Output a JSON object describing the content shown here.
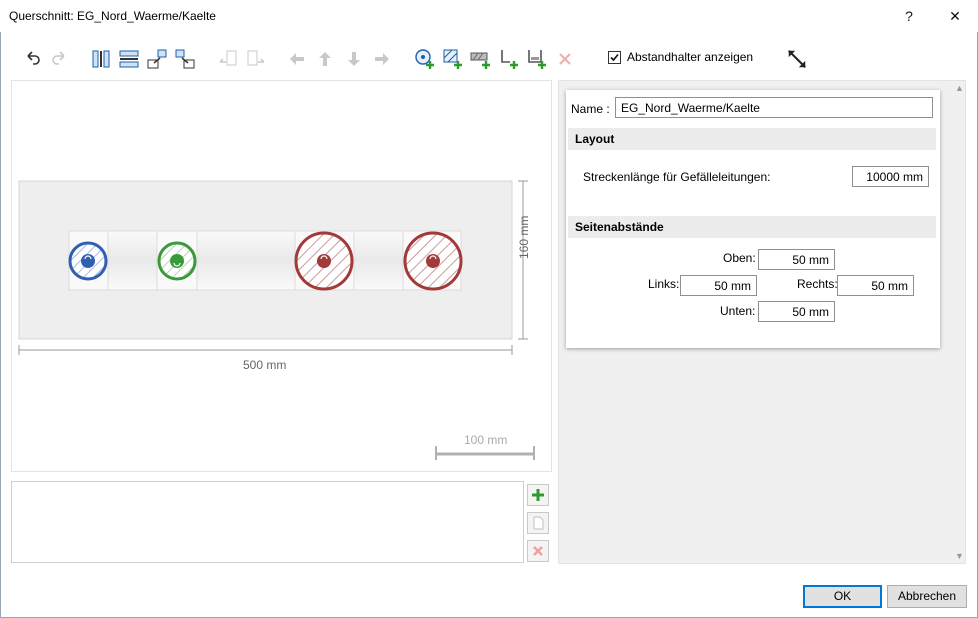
{
  "window": {
    "title": "Querschnitt: EG_Nord_Waerme/Kaelte",
    "help_label": "?",
    "close_label": "✕"
  },
  "toolbar": {
    "show_spacers_label": "Abstandhalter anzeigen",
    "show_spacers_checked": true,
    "icons": [
      "undo-icon",
      "redo-icon",
      "layout-vertical-icon",
      "layout-horizontal-icon",
      "import-left-icon",
      "import-right-icon",
      "export-left-icon",
      "export-right-icon",
      "arrow-left-icon",
      "arrow-up-icon",
      "arrow-down-icon",
      "arrow-right-icon",
      "add-pipe-icon",
      "add-area-icon",
      "add-box-icon",
      "add-support-icon",
      "add-hanger-icon",
      "delete-icon",
      "fit-view-icon"
    ]
  },
  "canvas": {
    "width_dim": "500 mm",
    "height_dim": "160 mm",
    "scale_label": "100 mm",
    "pipes": [
      {
        "color": "#2f5fb0",
        "size": "small"
      },
      {
        "color": "#3a9a3a",
        "size": "small"
      },
      {
        "color": "#a33a3a",
        "size": "large"
      },
      {
        "color": "#a33a3a",
        "size": "large"
      }
    ]
  },
  "properties": {
    "name_label": "Name :",
    "name_value": "EG_Nord_Waerme/Kaelte",
    "layout_header": "Layout",
    "slope_label": "Streckenlänge für Gefälleleitungen:",
    "slope_value": "10000 mm",
    "margins_header": "Seitenabstände",
    "top_label": "Oben:",
    "top_value": "50 mm",
    "left_label": "Links:",
    "left_value": "50 mm",
    "right_label": "Rechts:",
    "right_value": "50 mm",
    "bottom_label": "Unten:",
    "bottom_value": "50 mm"
  },
  "footer": {
    "ok_label": "OK",
    "cancel_label": "Abbrechen"
  }
}
